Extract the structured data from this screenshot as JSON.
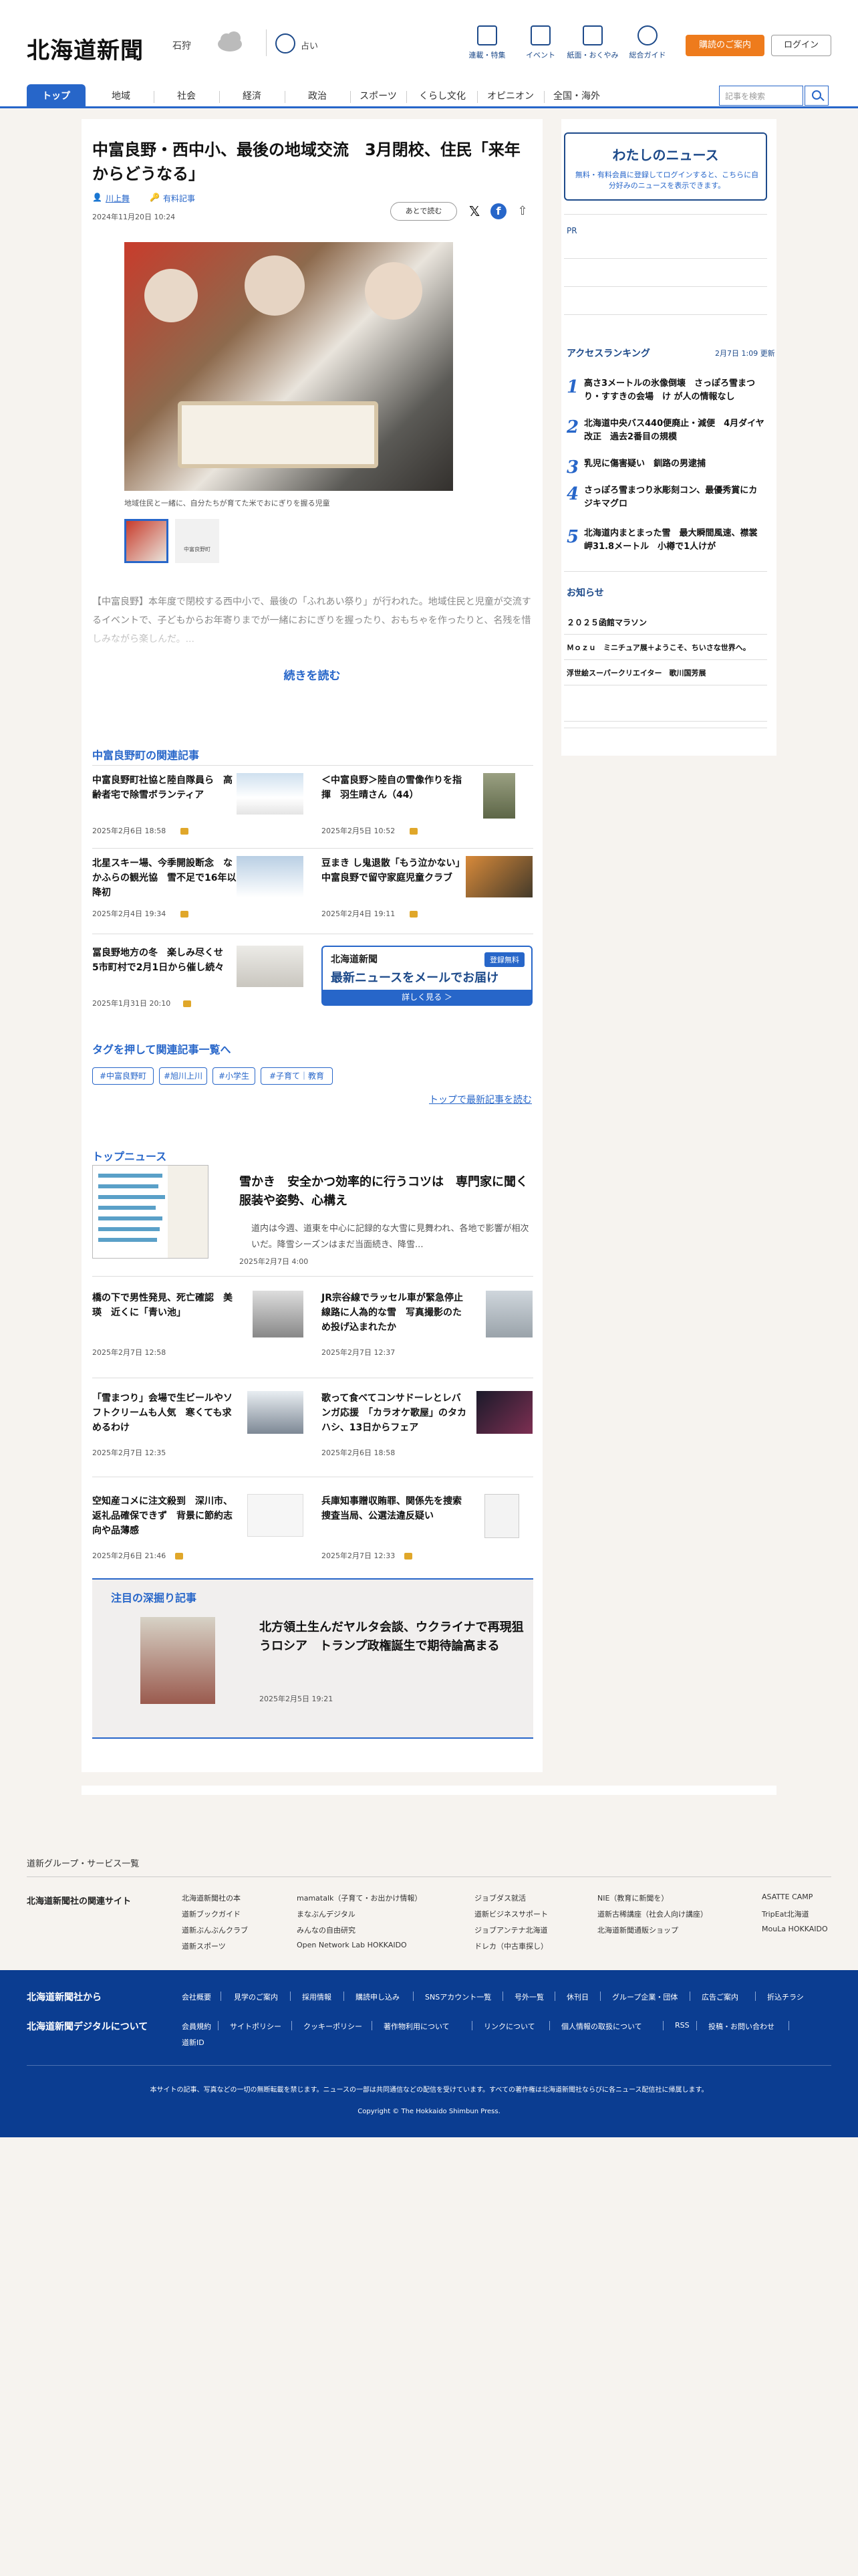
{
  "header": {
    "logo": "北海道新聞",
    "weather_place": "石狩",
    "weather2_label": "占い",
    "utility": [
      {
        "label": "連載・特集",
        "icon": "flag-icon"
      },
      {
        "label": "イベント",
        "icon": "calendar-icon"
      },
      {
        "label": "紙面・おくやみ",
        "icon": "newspaper-icon"
      },
      {
        "label": "総合ガイド",
        "icon": "help-icon"
      }
    ],
    "subscribe_label": "購読のご案内",
    "login_label": "ログイン"
  },
  "nav": {
    "items": [
      "トップ",
      "地域",
      "社会",
      "経済",
      "政治",
      "スポーツ",
      "くらし文化",
      "オピニオン",
      "全国・海外"
    ],
    "active": "トップ",
    "search_placeholder": "記事を検索"
  },
  "article": {
    "title": "中富良野・西中小、最後の地域交流　3月閉校、住民「来年からどうなる」",
    "author": "川上舞",
    "paid_label": "有料記事",
    "date": "2024年11月20日 10:24",
    "save_later": "あとで読む",
    "caption": "地域住民と一緒に、自分たちが育てた米でおにぎりを握る児童",
    "thumb2_label": "中富良野町",
    "lead": "【中富良野】本年度で閉校する西中小で、最後の「ふれあい祭り」が行われた。地域住民と児童が交流するイベントで、子どもからお年寄りまでが一緒におにぎりを握ったり、おもちゃを作ったりと、名残を惜しみながら楽しんだ。...",
    "read_more": "続きを読む"
  },
  "related": {
    "title": "中富良野町の関連記事",
    "items": [
      {
        "title": "中富良野町社協と陸自隊員ら　高齢者宅で除雪ボランティア",
        "date": "2025年2月6日 18:58",
        "paid": true
      },
      {
        "title": "＜中富良野＞陸自の雪像作りを指揮　羽生晴さん（44）",
        "date": "2025年2月5日 10:52",
        "paid": true
      },
      {
        "title": "北星スキー場、今季開設断念　なかふらの観光協　雪不足で16年以降初",
        "date": "2025年2月4日 19:34",
        "paid": true
      },
      {
        "title": "豆まき し鬼退散「もう泣かない」　中富良野で留守家庭児童クラブ",
        "date": "2025年2月4日 19:11",
        "paid": true
      },
      {
        "title": "冨良野地方の冬　楽しみ尽くせ　5市町村で2月1日から催し続々",
        "date": "2025年1月31日 20:10",
        "paid": true
      }
    ],
    "banner": {
      "logo": "北海道新聞",
      "free": "登録無料",
      "message": "最新ニュースをメールでお届け",
      "cta": "詳しく見る ＞"
    }
  },
  "tags": {
    "title": "タグを押して関連記事一覧へ",
    "items": [
      "#中富良野町",
      "#旭川上川",
      "#小学生",
      "#子育て｜教育"
    ],
    "top_link": "トップで最新記事を読む"
  },
  "top_news": {
    "title": "トップニュース",
    "hero": {
      "title": "雪かき　安全かつ効率的に行うコツは　専門家に聞く服装や姿勢、心構え",
      "lead": "道内は今週、道東を中心に記録的な大雪に見舞われ、各地で影響が相次いだ。降雪シーズンはまだ当面続き、降雪...",
      "date": "2025年2月7日 4:00"
    },
    "items": [
      {
        "title": "橋の下で男性発見、死亡確認　美瑛　近くに「青い池」",
        "date": "2025年2月7日 12:58",
        "paid": false
      },
      {
        "title": "JR宗谷線でラッセル車が緊急停止　線路に人為的な雪　写真撮影のため投げ込まれたか",
        "date": "2025年2月7日 12:37",
        "paid": false
      },
      {
        "title": "「雪まつり」会場で生ビールやソフトクリームも人気　寒くても求めるわけ",
        "date": "2025年2月7日 12:35",
        "paid": false
      },
      {
        "title": "歌って食べてコンサドーレとレバンガ応援　「カラオケ歌屋」のタカハシ、13日からフェア",
        "date": "2025年2月6日 18:58",
        "paid": false
      },
      {
        "title": "空知産コメに注文殺到　深川市、返礼品確保できず　背景に節約志向や品薄感",
        "date": "2025年2月6日 21:46",
        "paid": true
      },
      {
        "title": "兵庫知事贈収賄罪、関係先を捜索　捜査当局、公選法違反疑い",
        "date": "2025年2月7日 12:33",
        "paid": true
      }
    ]
  },
  "feature": {
    "title": "注目の深掘り記事",
    "article_title": "北方領土生んだヤルタ会談、ウクライナで再現狙うロシア　トランプ政権誕生で期待論高まる",
    "date": "2025年2月5日 19:21"
  },
  "sidebar": {
    "mynews_title": "わたしのニュース",
    "mynews_desc": "無料・有料会員に登録してログインすると、こちらに自分好みのニュースを表示できます。",
    "pr_label": "PR",
    "ranking_title": "アクセスランキング",
    "ranking_date": "2月7日 1:09 更新",
    "ranking": [
      {
        "rank": "1",
        "title": "高さ3メートルの氷像倒壊　さっぽろ雪まつり・すすきの会場　け が人の情報なし"
      },
      {
        "rank": "2",
        "title": "北海道中央バス440便廃止・減便　4月ダイヤ改正　過去2番目の規模"
      },
      {
        "rank": "3",
        "title": "乳児に傷害疑い　釧路の男逮捕"
      },
      {
        "rank": "4",
        "title": "さっぽろ雪まつり氷彫刻コン、最優秀賞にカジキマグロ"
      },
      {
        "rank": "5",
        "title": "北海道内まとまった雪　最大瞬間風速、襟裳岬31.8メートル　小樽で1人けが"
      }
    ],
    "notice_title": "お知らせ",
    "notices": [
      "２０２５函館マラソン",
      "Ｍｏｚｕ　ミニチュア展＋ようこそ、ちいさな世界へ。",
      "浮世絵スーパークリエイター　歌川国芳展"
    ]
  },
  "footer": {
    "group_link": "道新グループ・サービス一覧",
    "related_sites_title": "北海道新聞社の関連サイト",
    "sites": [
      [
        "北海道新聞社の本",
        "道新ブックガイド",
        "道新ぶんぶんクラブ",
        "道新スポーツ"
      ],
      [
        "mamatalk（子育て・お出かけ情報）",
        "まなぶんデジタル",
        "みんなの自由研究",
        "Open Network Lab HOKKAIDO"
      ],
      [
        "ジョブダス就活",
        "道新ビジネスサポート",
        "ジョブアンテナ北海道",
        "ドレカ（中古車探し）"
      ],
      [
        "NIE（教育に新聞を）",
        "道新古稀講座（社会人向け講座）",
        "北海道新聞通販ショップ"
      ],
      [
        "ASATTE CAMP",
        "TripEat北海道",
        "MouLa HOKKAIDO"
      ]
    ],
    "company_head": "北海道新聞社から",
    "company_links": [
      "会社概要",
      "見学のご案内",
      "採用情報",
      "購読申し込み",
      "SNSアカウント一覧",
      "号外一覧",
      "休刊日",
      "グループ企業・団体",
      "広告ご案内",
      "折込チラシ"
    ],
    "digital_head": "北海道新聞デジタルについて",
    "digital_links": [
      "会員規約",
      "サイトポリシー",
      "クッキーポリシー",
      "著作物利用について",
      "リンクについて",
      "個人情報の取扱について",
      "RSS",
      "投稿・お問い合わせ",
      "道新ID"
    ],
    "notice": "本サイトの記事、写真などの一切の無断転載を禁じます。ニュースの一部は共同通信などの配信を受けています。すべての著作権は北海道新聞社ならびに各ニュース配信社に帰属します。",
    "copyright": "Copyright © The Hokkaido Shimbun Press."
  },
  "colors": {
    "accent": "#2766c9",
    "navy": "#0b3d91",
    "orange": "#ee7b1c"
  }
}
